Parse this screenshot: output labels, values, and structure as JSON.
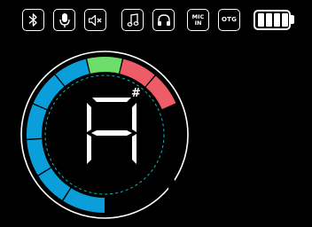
{
  "status_icons": [
    {
      "name": "bluetooth-icon"
    },
    {
      "name": "microphone-icon"
    },
    {
      "name": "speaker-mute-icon"
    },
    {
      "name": "music-note-icon"
    },
    {
      "name": "headphones-icon"
    },
    {
      "name": "mic-in-icon",
      "text": "MIC IN"
    },
    {
      "name": "otg-icon",
      "text": "OTG"
    }
  ],
  "battery": {
    "bars": 4,
    "level": 1.0
  },
  "tuner": {
    "note": "A",
    "accidental": "#",
    "meter_colors": {
      "low": "#0a9fdb",
      "in_tune": "#6ddd6b",
      "high": "#ee5d67",
      "inner_dash": "#18b1b8",
      "ring": "#ffffff"
    }
  }
}
